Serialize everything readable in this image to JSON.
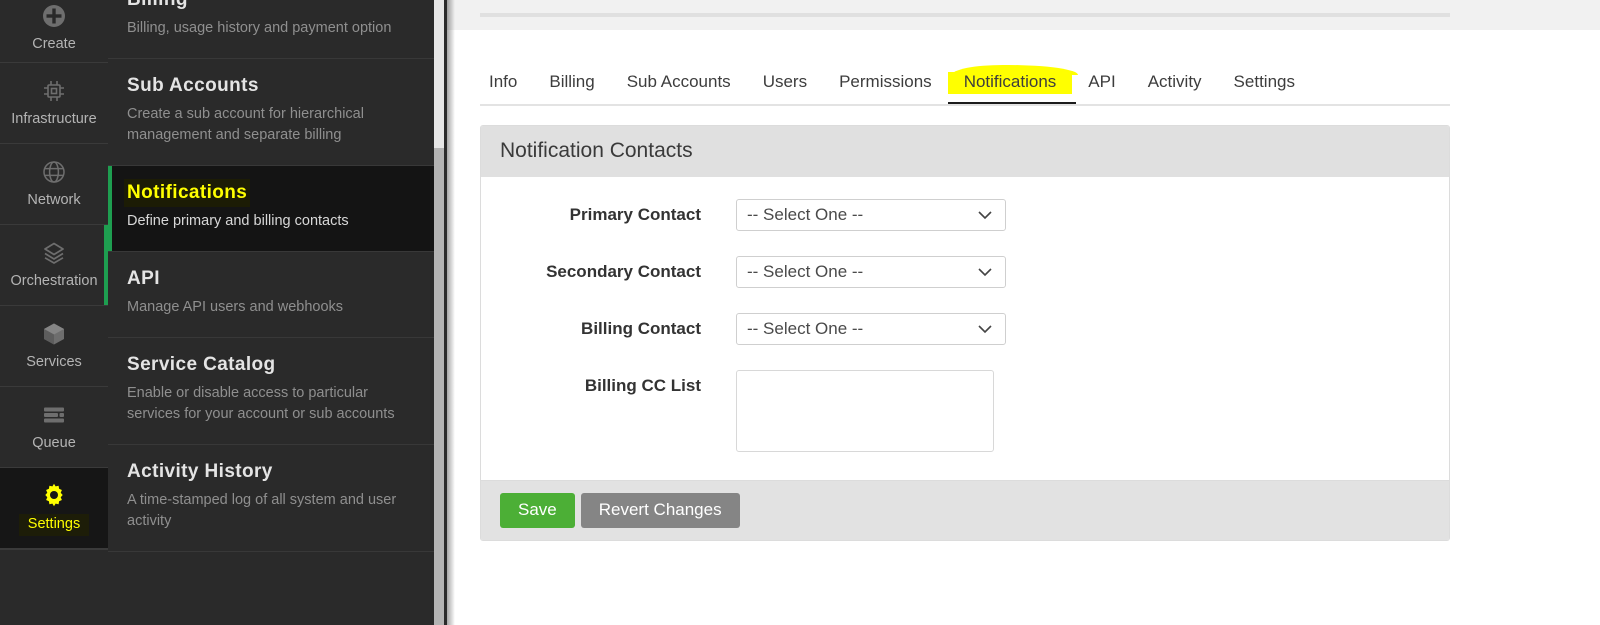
{
  "rail": {
    "items": [
      {
        "label": "Create",
        "icon": "plus-circle-icon",
        "state": "partial"
      },
      {
        "label": "Infrastructure",
        "icon": "chip-icon",
        "state": "normal"
      },
      {
        "label": "Network",
        "icon": "globe-icon",
        "state": "normal"
      },
      {
        "label": "Orchestration",
        "icon": "layers-icon",
        "state": "marked"
      },
      {
        "label": "Services",
        "icon": "cube-icon",
        "state": "normal"
      },
      {
        "label": "Queue",
        "icon": "queue-icon",
        "state": "normal"
      },
      {
        "label": "Settings",
        "icon": "gear-icon",
        "state": "active"
      }
    ]
  },
  "subnav": {
    "items": [
      {
        "title": "Billing",
        "desc": "Billing, usage history and payment option",
        "active": false
      },
      {
        "title": "Sub Accounts",
        "desc": "Create a sub account for hierarchical management and separate billing",
        "active": false
      },
      {
        "title": "Notifications",
        "desc": "Define primary and billing contacts",
        "active": true
      },
      {
        "title": "API",
        "desc": "Manage API users and webhooks",
        "active": false
      },
      {
        "title": "Service Catalog",
        "desc": "Enable or disable access to particular services for your account or sub accounts",
        "active": false
      },
      {
        "title": "Activity History",
        "desc": "A time-stamped log of all system and user activity",
        "active": false
      }
    ]
  },
  "tabs": [
    {
      "label": "Info",
      "selected": false
    },
    {
      "label": "Billing",
      "selected": false
    },
    {
      "label": "Sub Accounts",
      "selected": false
    },
    {
      "label": "Users",
      "selected": false
    },
    {
      "label": "Permissions",
      "selected": false
    },
    {
      "label": "Notifications",
      "selected": true
    },
    {
      "label": "API",
      "selected": false
    },
    {
      "label": "Activity",
      "selected": false
    },
    {
      "label": "Settings",
      "selected": false
    }
  ],
  "card": {
    "title": "Notification Contacts",
    "fields": [
      {
        "label": "Primary Contact",
        "type": "select",
        "value": "-- Select One --"
      },
      {
        "label": "Secondary Contact",
        "type": "select",
        "value": "-- Select One --"
      },
      {
        "label": "Billing Contact",
        "type": "select",
        "value": "-- Select One --"
      },
      {
        "label": "Billing CC List",
        "type": "textarea",
        "value": ""
      }
    ],
    "buttons": {
      "save": "Save",
      "revert": "Revert Changes"
    }
  },
  "colors": {
    "highlight": "#ffff00",
    "accent_green": "#1e9e50",
    "save_green": "#4caf36",
    "revert_gray": "#858585",
    "rail_bg": "#2a2a2a",
    "card_head": "#e0e0e0"
  }
}
